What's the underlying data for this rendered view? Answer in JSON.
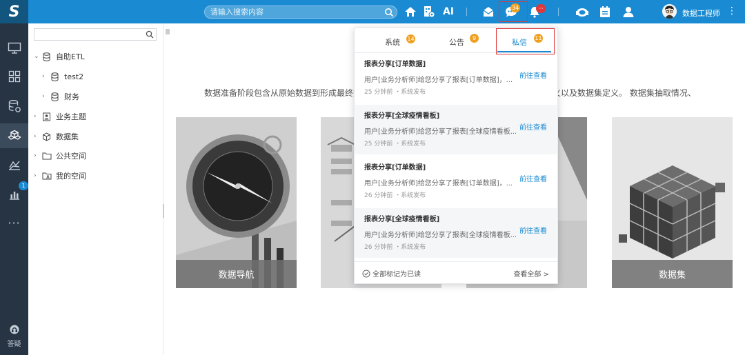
{
  "app": {
    "logo": "S"
  },
  "search": {
    "placeholder": "请输入搜索内容"
  },
  "header": {
    "ai_label": "AI",
    "badges": {
      "messages": "34",
      "alerts": "···"
    },
    "user_name": "数据工程师",
    "more": "⋮"
  },
  "rail": {
    "alert_badge": "1",
    "help_label": "答疑"
  },
  "tree": {
    "items": [
      {
        "label": "自助ETL",
        "icon": "database-icon"
      },
      {
        "label": "test2",
        "icon": "database-icon"
      },
      {
        "label": "财务",
        "icon": "database-icon"
      },
      {
        "label": "业务主题",
        "icon": "topic-icon"
      },
      {
        "label": "数据集",
        "icon": "cube-icon"
      },
      {
        "label": "公共空间",
        "icon": "folder-icon"
      },
      {
        "label": "我的空间",
        "icon": "user-folder-icon"
      }
    ]
  },
  "main": {
    "intro_left": "数据准备阶段包含从原始数据到形成最终数",
    "intro_right": "定义以及数据集定义。 数据集抽取情况、",
    "cards": [
      {
        "caption": "数据导航"
      },
      {
        "caption": ""
      },
      {
        "caption": ""
      },
      {
        "caption": "数据集"
      }
    ]
  },
  "notifications": {
    "tabs": [
      {
        "label": "系统",
        "count": "14"
      },
      {
        "label": "公告",
        "count": "9"
      },
      {
        "label": "私信",
        "count": "11"
      }
    ],
    "active_tab": "私信",
    "messages": [
      {
        "title": "报表分享[订单数据]",
        "body": "用户[业务分析师]给您分享了报表[订单数据]，...",
        "link": "前往查看",
        "meta": "25 分钟前 ・系统发布"
      },
      {
        "title": "报表分享[全球疫情看板]",
        "body": "用户[业务分析师]给您分享了报表[全球疫情看板...",
        "link": "前往查看",
        "meta": "25 分钟前 ・系统发布"
      },
      {
        "title": "报表分享[订单数据]",
        "body": "用户[业务分析师]给您分享了报表[订单数据]，...",
        "link": "前往查看",
        "meta": "26 分钟前 ・系统发布"
      },
      {
        "title": "报表分享[全球疫情看板]",
        "body": "用户[业务分析师]给您分享了报表[全球疫情看板...",
        "link": "前往查看",
        "meta": "26 分钟前 ・系统发布"
      }
    ],
    "mark_all_read": "全部标记为已读",
    "view_all": "查看全部 >"
  },
  "colors": {
    "topbar": "#1a8bd2",
    "rail": "#263443",
    "accent": "#1a8bd2",
    "highlight_box": "#e0373a",
    "badge_orange": "#f0a020",
    "badge_red": "#e0373a"
  }
}
